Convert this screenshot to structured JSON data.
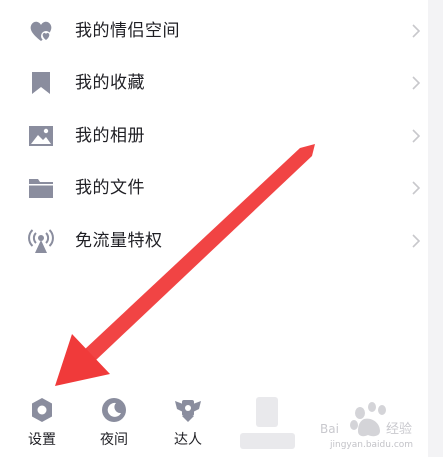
{
  "menu": {
    "items": [
      {
        "label": "我的情侣空间",
        "icon": "heart-icon"
      },
      {
        "label": "我的收藏",
        "icon": "bookmark-icon"
      },
      {
        "label": "我的相册",
        "icon": "photo-icon"
      },
      {
        "label": "我的文件",
        "icon": "folder-icon"
      },
      {
        "label": "免流量特权",
        "icon": "broadcast-tower-icon"
      }
    ]
  },
  "bottom_bar": {
    "settings_label": "设置",
    "night_label": "夜间",
    "expert_label": "达人"
  },
  "watermark": {
    "text": "jingyan.baidu.com",
    "logo_text": "Bai 经验"
  },
  "colors": {
    "icon": "#8a8d9e",
    "chevron": "#c8c8cc",
    "arrow": "#f03a3a"
  }
}
